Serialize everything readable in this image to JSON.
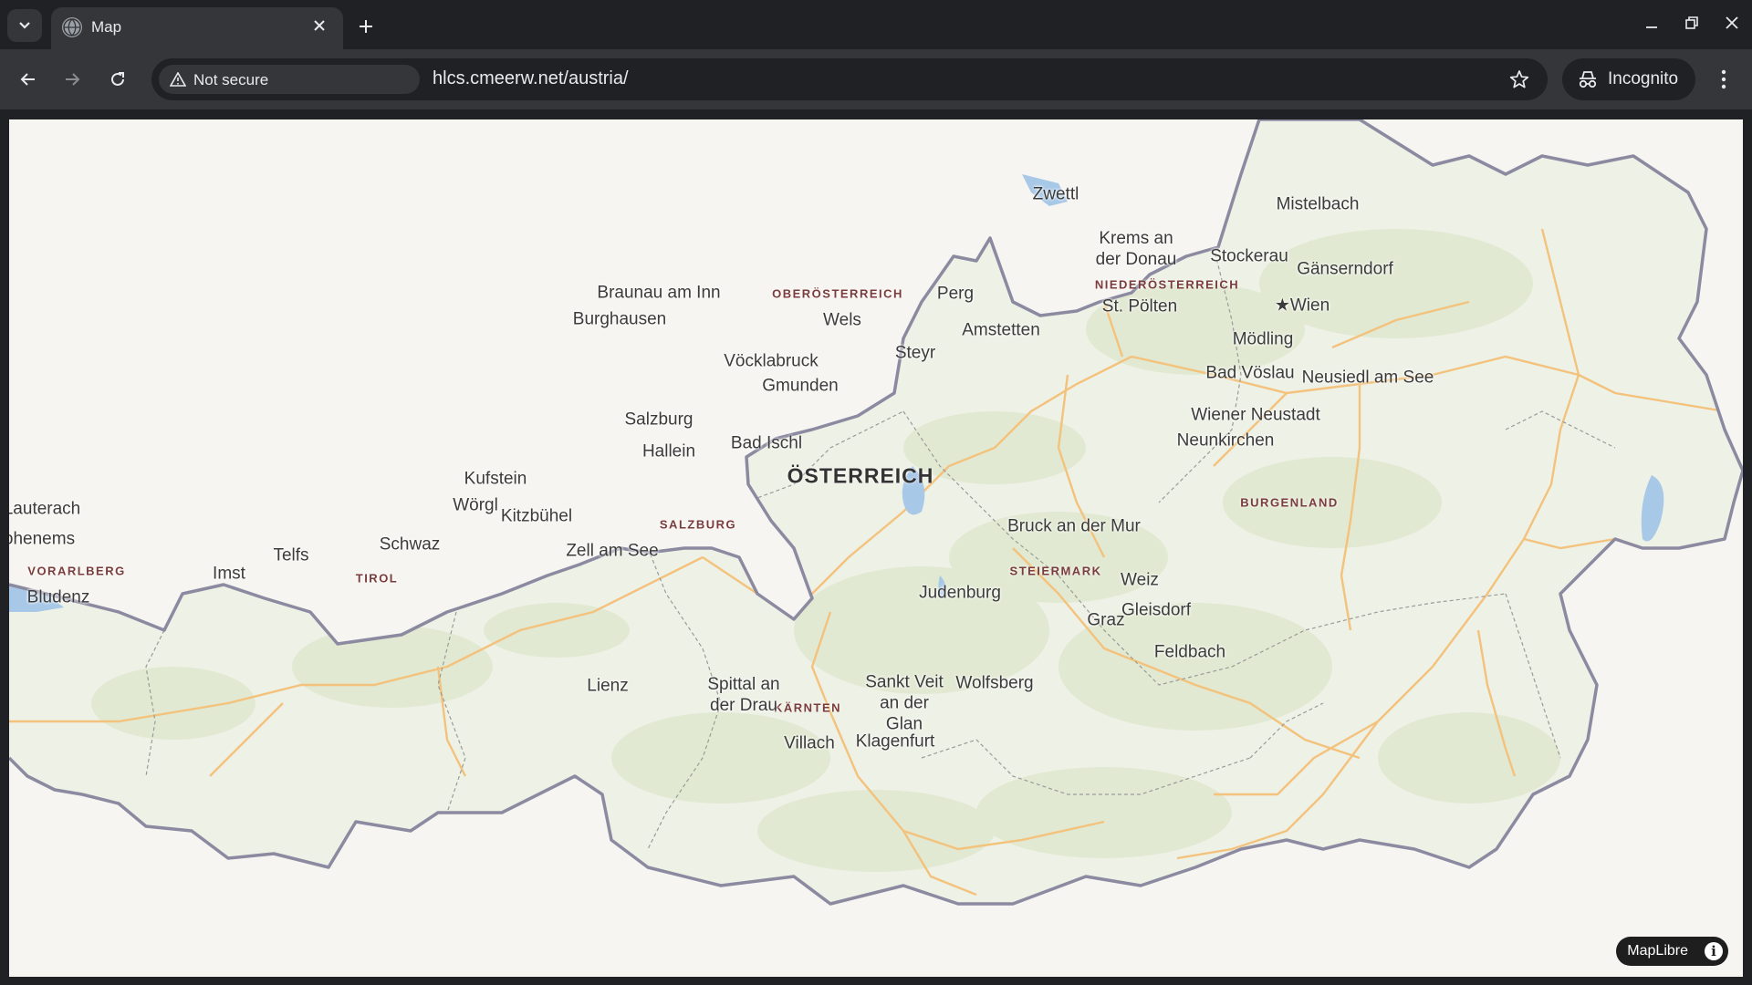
{
  "browser": {
    "tab_title": "Map",
    "security_label": "Not secure",
    "url": "hlcs.cmeerw.net/austria/",
    "incognito_label": "Incognito"
  },
  "icons": [
    "tab-dropdown-icon",
    "globe-icon",
    "close-icon",
    "plus-icon",
    "minimize-icon",
    "restore-icon",
    "window-close-icon",
    "back-icon",
    "forward-icon",
    "reload-icon",
    "warning-icon",
    "star-icon",
    "incognito-icon",
    "kebab-menu-icon",
    "info-icon",
    "capital-star-icon"
  ],
  "map": {
    "country": "ÖSTERREICH",
    "regions": {
      "oberoesterreich": "OBERÖSTERREICH",
      "niederoesterreich": "NIEDERÖSTERREICH",
      "salzburg": "SALZBURG",
      "tirol": "TIROL",
      "vorarlberg": "VORARLBERG",
      "steiermark": "STEIERMARK",
      "kaernten": "KÄRNTEN",
      "burgenland": "BURGENLAND"
    },
    "cities": {
      "zwettl": "Zwettl",
      "mistelbach": "Mistelbach",
      "krems": "Krems an der Donau",
      "stockerau": "Stockerau",
      "gaenserndorf": "Gänserndorf",
      "braunau": "Braunau am Inn",
      "burghausen": "Burghausen",
      "perg": "Perg",
      "wels": "Wels",
      "st_poelten": "St. Pölten",
      "wien": "Wien",
      "amstetten": "Amstetten",
      "moedling": "Mödling",
      "steyr": "Steyr",
      "voecklabruck": "Vöcklabruck",
      "bad_voeslau": "Bad Vöslau",
      "neusiedl": "Neusiedl am See",
      "gmunden": "Gmunden",
      "wiener_neustadt": "Wiener Neustadt",
      "salzburg": "Salzburg",
      "neunkirchen": "Neunkirchen",
      "bad_ischl": "Bad Ischl",
      "hallein": "Hallein",
      "kufstein": "Kufstein",
      "lauterach": "Lauterach",
      "woergl": "Wörgl",
      "kitzbuehel": "Kitzbühel",
      "bruck": "Bruck an der Mur",
      "hohenems": "ohenems",
      "schwaz": "Schwaz",
      "zell": "Zell am See",
      "telfs": "Telfs",
      "imst": "Imst",
      "bludenz": "Bludenz",
      "weiz": "Weiz",
      "judenburg": "Judenburg",
      "gleisdorf": "Gleisdorf",
      "graz": "Graz",
      "feldbach": "Feldbach",
      "wolfsberg": "Wolfsberg",
      "lienz": "Lienz",
      "spittal": "Spittal an der Drau",
      "sankt_veit": "Sankt Veit an der Glan",
      "klagenfurt": "Klagenfurt",
      "villach": "Villach"
    },
    "attribution": "MapLibre",
    "info_glyph": "i"
  }
}
